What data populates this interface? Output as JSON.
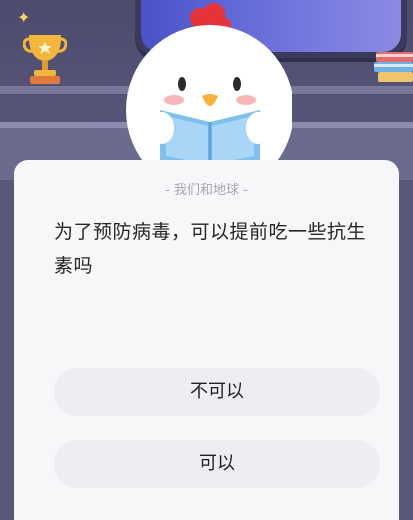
{
  "header": {
    "category": "- 我们和地球 -"
  },
  "question": {
    "text": "为了预防病毒，可以提前吃一些抗生素吗"
  },
  "options": [
    {
      "label": "不可以"
    },
    {
      "label": "可以"
    }
  ],
  "colors": {
    "card_background": "#f7f7fa",
    "option_background": "#eceef2",
    "scene_background": "#4d4b6c",
    "accent_red": "#e8323a",
    "book_blue": "#7fc0ee"
  },
  "icons": {
    "trophy": "trophy-icon",
    "sparkle": "sparkle-icon",
    "books": "books-icon",
    "mascot": "chick-mascot"
  }
}
